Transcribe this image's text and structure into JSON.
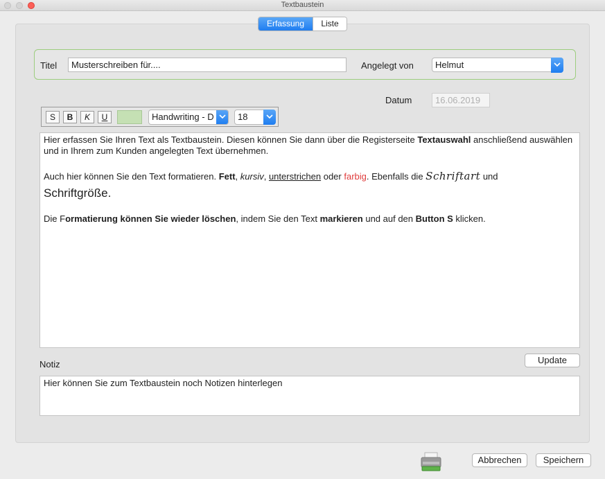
{
  "window": {
    "title": "Textbaustein"
  },
  "tabs": [
    {
      "label": "Erfassung"
    },
    {
      "label": "Liste"
    }
  ],
  "form": {
    "titel_label": "Titel",
    "titel_value": "Musterschreiben für....",
    "angelegt_label": "Angelegt von",
    "angelegt_value": "Helmut",
    "datum_label": "Datum",
    "datum_value": "16.06.2019"
  },
  "toolbar": {
    "clear_label": "S",
    "bold_label": "B",
    "italic_label": "K",
    "underline_label": "U",
    "font_value": "Handwriting - D",
    "size_value": "18"
  },
  "editor": {
    "p1_a": "Hier erfassen Sie Ihren Text als Textbaustein. Diesen können Sie dann über die Registerseite ",
    "p1_b": "Textauswahl",
    "p1_c": " anschließend auswählen und in Ihrem zum Kunden angelegten Text übernehmen.",
    "p2_a": "Auch hier können Sie den Text formatieren. ",
    "p2_bold": "Fett",
    "p2_sep1": ", ",
    "p2_italic": "kursiv",
    "p2_sep2": ", ",
    "p2_underline": "unterstrichen",
    "p2_sep3": " oder ",
    "p2_color": "farbig",
    "p2_b": ". Ebenfalls die ",
    "p2_script": "Schriftart",
    "p2_c": "  und",
    "p2_big": "Schriftgröße.",
    "p3_a": "Die F",
    "p3_b": "ormatierung können Sie wieder löschen",
    "p3_c": ", indem Sie den Text ",
    "p3_d": "markieren",
    "p3_e": " und auf den ",
    "p3_f": "Button S",
    "p3_g": " klicken."
  },
  "colors": {
    "accent": "#1f7df0",
    "red_text": "#e03c3c",
    "green_border": "#9ccd7e"
  },
  "update_label": "Update",
  "notiz": {
    "label": "Notiz",
    "value": "Hier können Sie zum Textbaustein noch Notizen hinterlegen"
  },
  "footer": {
    "print_icon": "printer-icon",
    "cancel_label": "Abbrechen",
    "save_label": "Speichern"
  }
}
